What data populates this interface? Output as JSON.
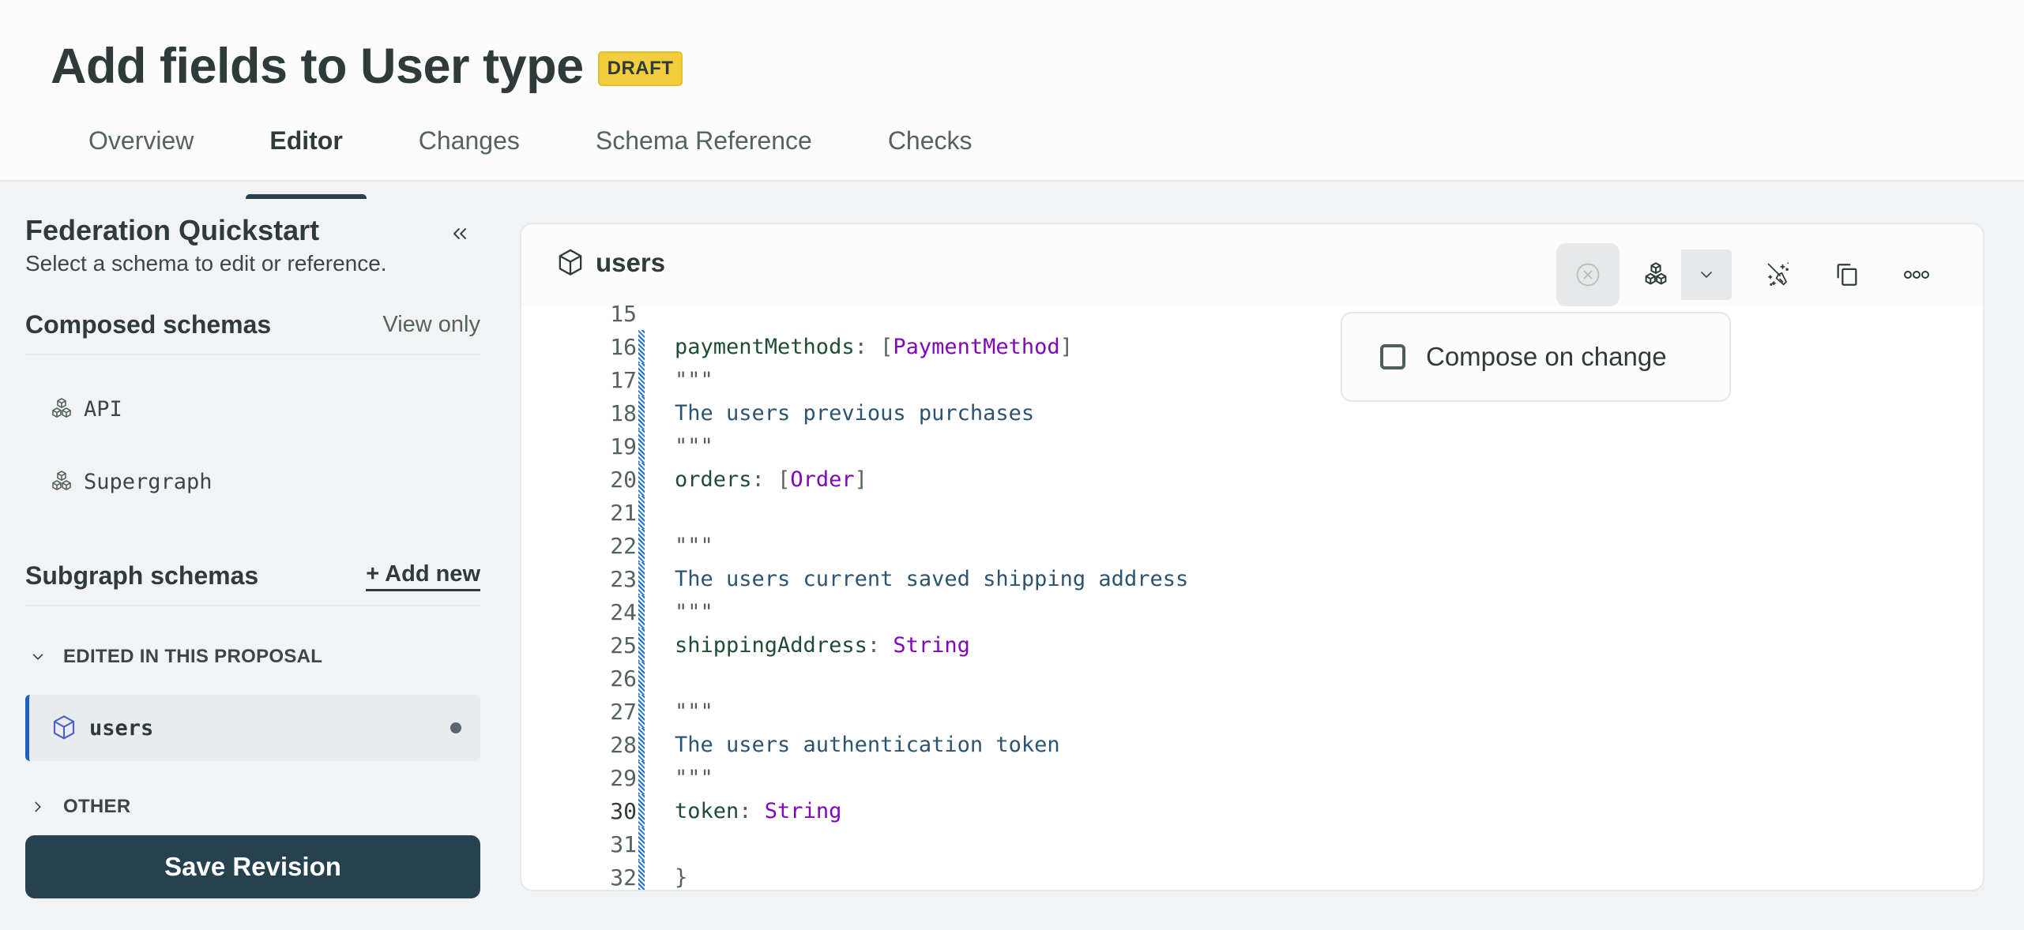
{
  "header": {
    "title": "Add fields to User type",
    "badge": "DRAFT",
    "tabs": [
      {
        "label": "Overview",
        "active": false
      },
      {
        "label": "Editor",
        "active": true
      },
      {
        "label": "Changes",
        "active": false
      },
      {
        "label": "Schema Reference",
        "active": false
      },
      {
        "label": "Checks",
        "active": false
      }
    ]
  },
  "sidebar": {
    "title": "Federation Quickstart",
    "subtitle": "Select a schema to edit or reference.",
    "collapse_icon": "double-chevron-left-icon",
    "composed": {
      "title": "Composed schemas",
      "note": "View only",
      "items": [
        {
          "label": "API",
          "icon": "cubes-icon"
        },
        {
          "label": "Supergraph",
          "icon": "cubes-icon"
        }
      ]
    },
    "subgraphs": {
      "title": "Subgraph schemas",
      "add_label": "+ Add new",
      "groups": [
        {
          "label": "EDITED IN THIS PROPOSAL",
          "expanded": true,
          "items": [
            {
              "label": "users",
              "icon": "cube-icon",
              "selected": true,
              "modified": true
            }
          ]
        },
        {
          "label": "OTHER",
          "expanded": false,
          "items": []
        }
      ]
    },
    "save_label": "Save Revision"
  },
  "editor": {
    "file_name": "users",
    "toolbar": {
      "cancel": "x-circle-icon",
      "compose": "cubes-icon",
      "dropdown": "chevron-down-icon",
      "prettify": "broom-sparkle-icon",
      "copy": "copy-icon",
      "more": "ellipsis-icon"
    },
    "active_line": 30,
    "lines": [
      {
        "n": "15",
        "modified": false,
        "tokens": []
      },
      {
        "n": "16",
        "modified": true,
        "tokens": [
          {
            "t": "paymentMethods",
            "c": "field"
          },
          {
            "t": ": ",
            "c": "punct"
          },
          {
            "t": "[",
            "c": "punct"
          },
          {
            "t": "PaymentMethod",
            "c": "type"
          },
          {
            "t": "]",
            "c": "punct"
          }
        ]
      },
      {
        "n": "17",
        "modified": true,
        "tokens": [
          {
            "t": "\"\"\"",
            "c": "quote"
          }
        ]
      },
      {
        "n": "18",
        "modified": true,
        "tokens": [
          {
            "t": "The users previous purchases",
            "c": "desc"
          }
        ]
      },
      {
        "n": "19",
        "modified": true,
        "tokens": [
          {
            "t": "\"\"\"",
            "c": "quote"
          }
        ]
      },
      {
        "n": "20",
        "modified": true,
        "tokens": [
          {
            "t": "orders",
            "c": "field"
          },
          {
            "t": ": ",
            "c": "punct"
          },
          {
            "t": "[",
            "c": "punct"
          },
          {
            "t": "Order",
            "c": "type"
          },
          {
            "t": "]",
            "c": "punct"
          }
        ]
      },
      {
        "n": "21",
        "modified": true,
        "tokens": []
      },
      {
        "n": "22",
        "modified": true,
        "tokens": [
          {
            "t": "\"\"\"",
            "c": "quote"
          }
        ]
      },
      {
        "n": "23",
        "modified": true,
        "tokens": [
          {
            "t": "The users current saved shipping address",
            "c": "desc"
          }
        ]
      },
      {
        "n": "24",
        "modified": true,
        "tokens": [
          {
            "t": "\"\"\"",
            "c": "quote"
          }
        ]
      },
      {
        "n": "25",
        "modified": true,
        "tokens": [
          {
            "t": "shippingAddress",
            "c": "field"
          },
          {
            "t": ": ",
            "c": "punct"
          },
          {
            "t": "String",
            "c": "type"
          }
        ]
      },
      {
        "n": "26",
        "modified": true,
        "tokens": []
      },
      {
        "n": "27",
        "modified": true,
        "tokens": [
          {
            "t": "\"\"\"",
            "c": "quote"
          }
        ]
      },
      {
        "n": "28",
        "modified": true,
        "tokens": [
          {
            "t": "The users authentication token",
            "c": "desc"
          }
        ]
      },
      {
        "n": "29",
        "modified": true,
        "tokens": [
          {
            "t": "\"\"\"",
            "c": "quote"
          }
        ]
      },
      {
        "n": "30",
        "modified": true,
        "tokens": [
          {
            "t": "token",
            "c": "field"
          },
          {
            "t": ": ",
            "c": "punct"
          },
          {
            "t": "String",
            "c": "type"
          }
        ]
      },
      {
        "n": "31",
        "modified": true,
        "tokens": []
      },
      {
        "n": "32",
        "modified": true,
        "tokens": [
          {
            "t": "}",
            "c": "punct"
          }
        ]
      }
    ]
  },
  "popover": {
    "checkbox_label": "Compose on change",
    "checked": false
  },
  "colors": {
    "primary_dark": "#264150",
    "badge": "#f2cd3e",
    "accent_blue": "#1c5fbc",
    "type_purple": "#8206b9",
    "field_green": "#1e4d34",
    "desc_blue": "#2c5470"
  }
}
